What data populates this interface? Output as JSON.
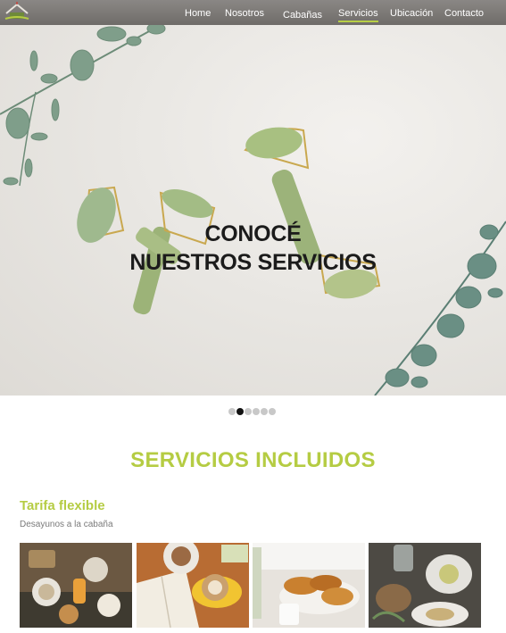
{
  "nav": {
    "items": [
      {
        "label": "Home"
      },
      {
        "label": "Nosotros"
      },
      {
        "label": "Cabañas"
      },
      {
        "label": "Servicios"
      },
      {
        "label": "Ubicación"
      },
      {
        "label": "Contacto"
      }
    ],
    "active": "Servicios",
    "active_color": "#b7cf45"
  },
  "hero": {
    "title_line1": "CONOCÉ",
    "title_line2": "NUESTROS SERVICIOS"
  },
  "carousel": {
    "slide_count": 6,
    "current_index": 1
  },
  "section": {
    "title": "SERVICIOS INCLUIDOS",
    "accent_color": "#b5cc43"
  },
  "service": {
    "title": "Tarifa flexible",
    "subtitle": "Desayunos a la cabaña"
  }
}
